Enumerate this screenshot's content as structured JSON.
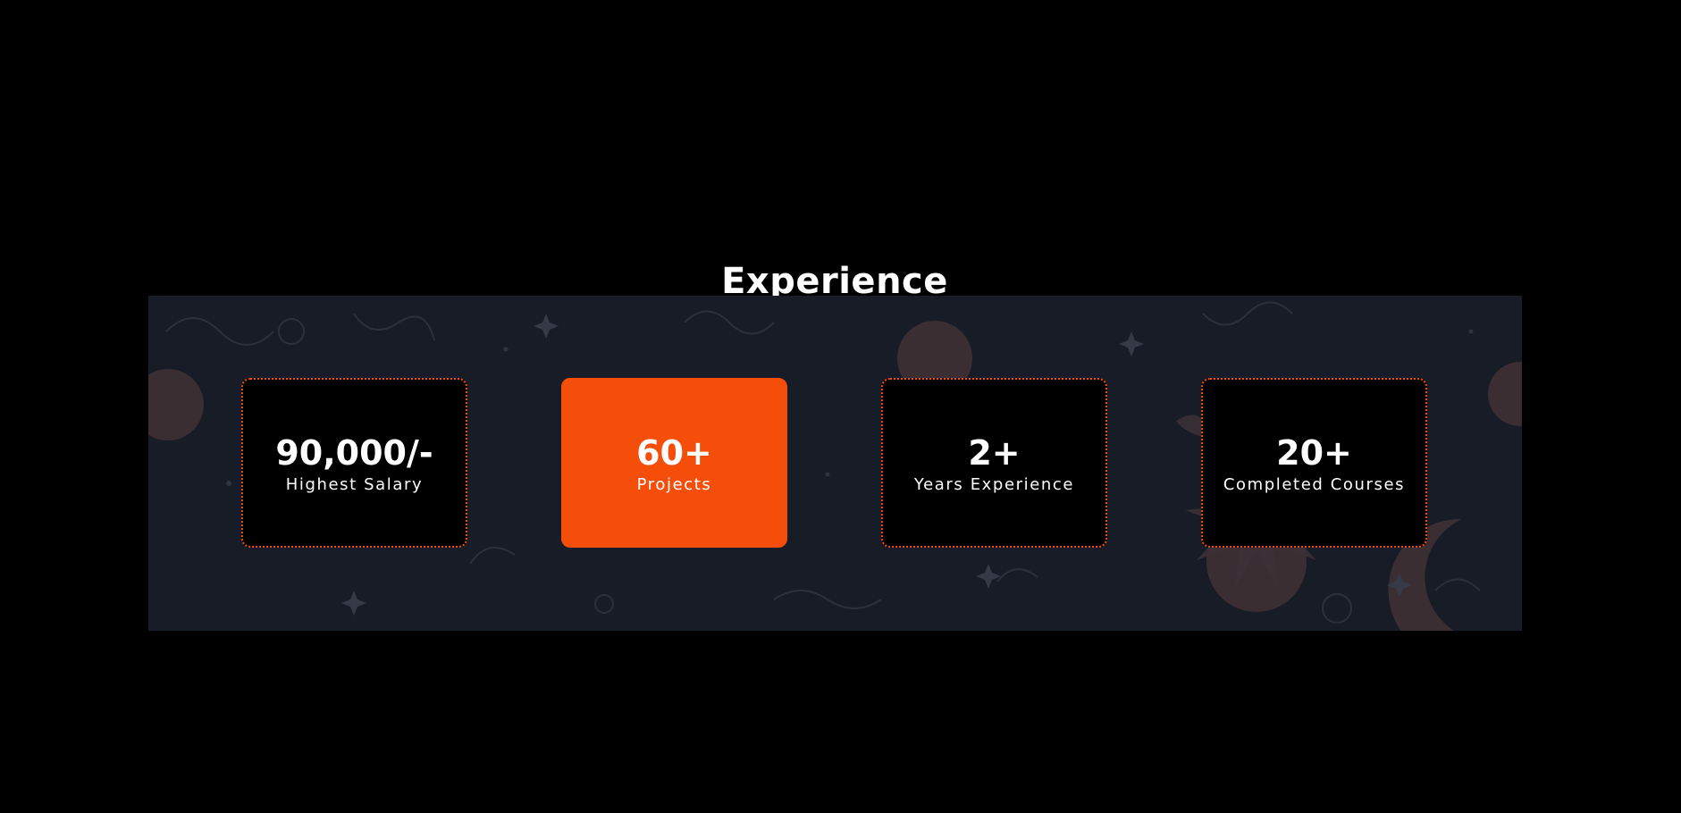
{
  "section": {
    "title": "Experience"
  },
  "colors": {
    "page_background": "#000000",
    "banner_background": "#181c26",
    "accent": "#f54e0b",
    "card_background": "#000000",
    "text": "#ffffff"
  },
  "background_motif_icons": [
    "sun-icon",
    "moon-icon",
    "star-icon",
    "swirl-icon"
  ],
  "stats": [
    {
      "value": "90,000/-",
      "label": "Highest Salary",
      "highlighted": false
    },
    {
      "value": "60+",
      "label": "Projects",
      "highlighted": true
    },
    {
      "value": "2+",
      "label": "Years Experience",
      "highlighted": false
    },
    {
      "value": "20+",
      "label": "Completed Courses",
      "highlighted": false
    }
  ]
}
